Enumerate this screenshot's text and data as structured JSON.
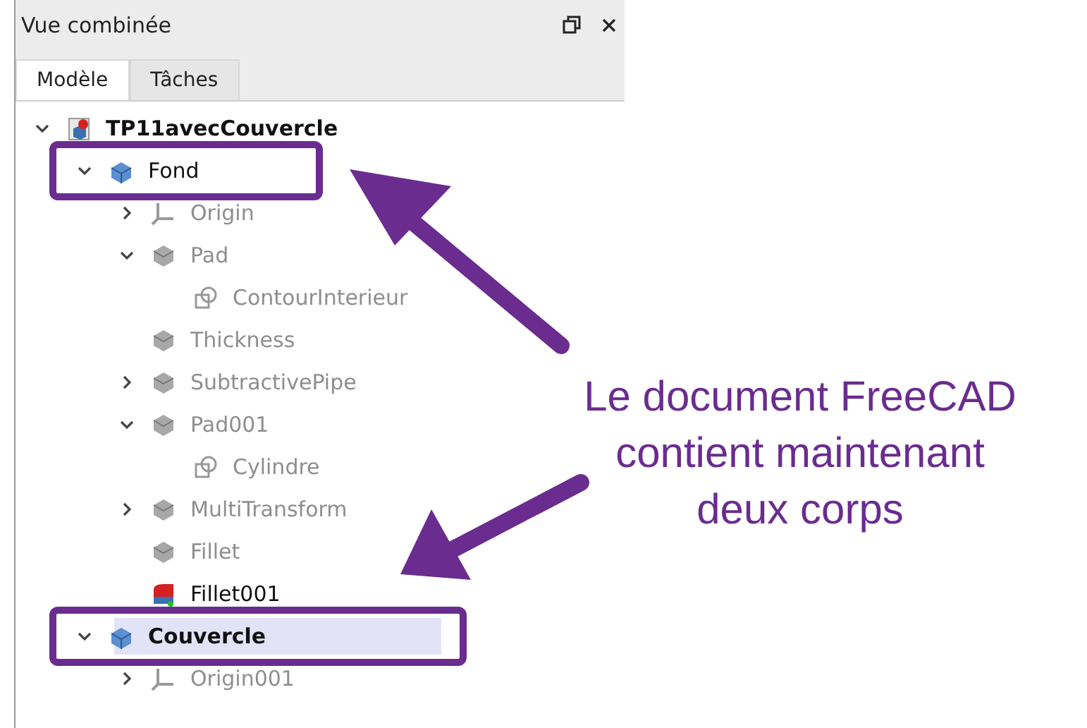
{
  "panel": {
    "title": "Vue combinée"
  },
  "tabs": [
    {
      "label": "Modèle",
      "selected": true
    },
    {
      "label": "Tâches",
      "selected": false
    }
  ],
  "tree": [
    {
      "label": "TP11avecCouvercle",
      "kind": "document",
      "expanded": true,
      "bold": true,
      "dimmed": false,
      "selected": false,
      "highlighted": false,
      "children": [
        {
          "label": "Fond",
          "kind": "body",
          "expanded": true,
          "bold": false,
          "dimmed": false,
          "selected": false,
          "highlighted": true,
          "children": [
            {
              "label": "Origin",
              "kind": "origin",
              "expanded": false,
              "bold": false,
              "dimmed": true,
              "selected": false,
              "highlighted": false
            },
            {
              "label": "Pad",
              "kind": "pad",
              "expanded": true,
              "bold": false,
              "dimmed": true,
              "selected": false,
              "highlighted": false,
              "children": [
                {
                  "label": "ContourInterieur",
                  "kind": "sketch",
                  "bold": false,
                  "dimmed": true,
                  "selected": false,
                  "highlighted": false
                }
              ]
            },
            {
              "label": "Thickness",
              "kind": "thickness",
              "bold": false,
              "dimmed": true,
              "selected": false,
              "highlighted": false
            },
            {
              "label": "SubtractivePipe",
              "kind": "pipe",
              "expanded": false,
              "bold": false,
              "dimmed": true,
              "selected": false,
              "highlighted": false
            },
            {
              "label": "Pad001",
              "kind": "pad",
              "expanded": true,
              "bold": false,
              "dimmed": true,
              "selected": false,
              "highlighted": false,
              "children": [
                {
                  "label": "Cylindre",
                  "kind": "sketch",
                  "bold": false,
                  "dimmed": true,
                  "selected": false,
                  "highlighted": false
                }
              ]
            },
            {
              "label": "MultiTransform",
              "kind": "multi",
              "expanded": false,
              "bold": false,
              "dimmed": true,
              "selected": false,
              "highlighted": false
            },
            {
              "label": "Fillet",
              "kind": "fillet",
              "bold": false,
              "dimmed": true,
              "selected": false,
              "highlighted": false
            },
            {
              "label": "Fillet001",
              "kind": "tip",
              "bold": false,
              "dimmed": false,
              "selected": false,
              "highlighted": false
            }
          ]
        },
        {
          "label": "Couvercle",
          "kind": "body",
          "expanded": true,
          "bold": true,
          "dimmed": false,
          "selected": true,
          "highlighted": true,
          "children": [
            {
              "label": "Origin001",
              "kind": "origin",
              "expanded": false,
              "bold": false,
              "dimmed": true,
              "selected": false,
              "highlighted": false
            }
          ]
        }
      ]
    }
  ],
  "callout": {
    "text": "Le document FreeCAD contient maintenant deux corps"
  }
}
